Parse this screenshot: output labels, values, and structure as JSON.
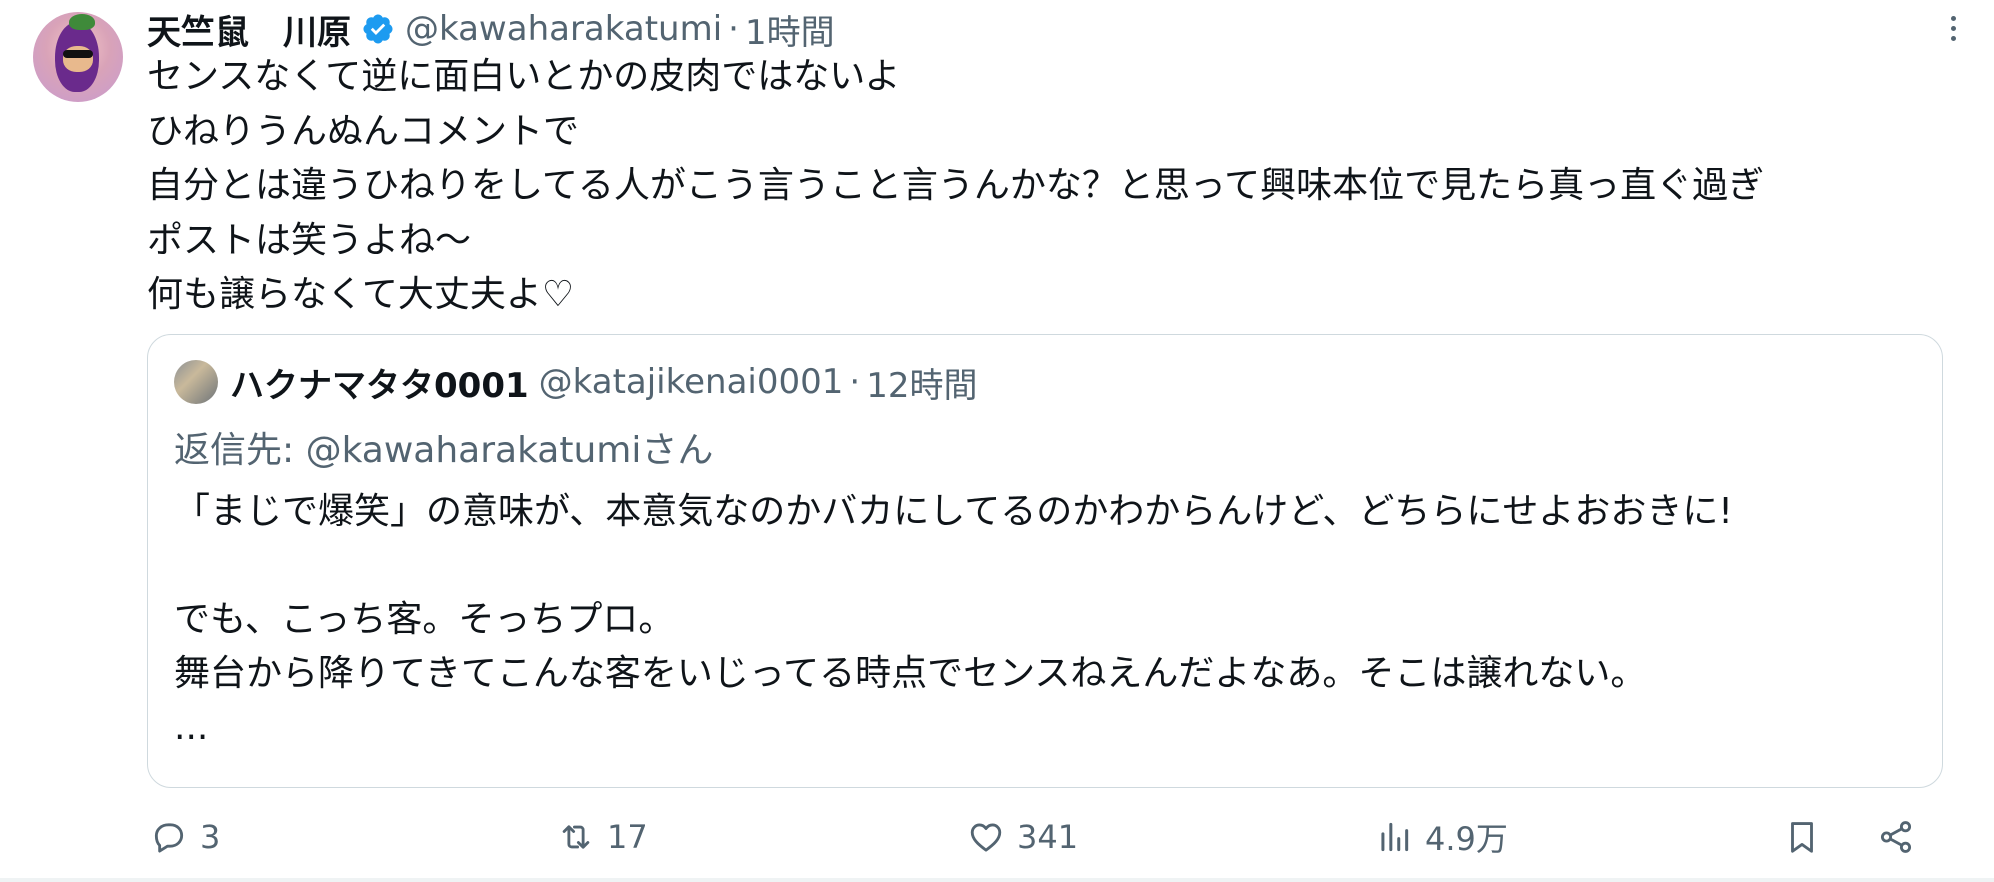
{
  "tweet": {
    "author": {
      "display_name": "天竺鼠　川原",
      "handle": "@kawaharakatumi",
      "separator": "·",
      "time": "1時間",
      "verified": true
    },
    "body_lines": [
      "センスなくて逆に面白いとかの皮肉ではないよ",
      "ひねりうんぬんコメントで",
      "自分とは違うひねりをしてる人がこう言うこと言うんかな？と思って興味本位で見たら真っ直ぐ過ぎ",
      "ポストは笑うよね〜",
      "何も譲らなくて大丈夫よ♡"
    ],
    "quote": {
      "display_name": "ハクナマタタ0001",
      "handle": "@katajikenai0001",
      "separator": "·",
      "time": "12時間",
      "reply_prefix": "返信先: ",
      "reply_to": "@kawaharakatumi",
      "reply_suffix": "さん",
      "body_lines": [
        "「まじで爆笑」の意味が、本意気なのかバカにしてるのかわからんけど、どちらにせよおおきに!",
        "",
        "でも、こっち客。そっちプロ。",
        "舞台から降りてきてこんな客をいじってる時点でセンスねえんだよなあ。そこは譲れない。",
        "..."
      ]
    },
    "actions": {
      "reply_count": "3",
      "retweet_count": "17",
      "like_count": "341",
      "view_count": "4.9万"
    }
  },
  "icons": {
    "verified": "verified-badge-icon",
    "more": "more-options-icon",
    "reply": "reply-icon",
    "retweet": "retweet-icon",
    "like": "heart-icon",
    "views": "views-icon",
    "bookmark": "bookmark-icon",
    "share": "share-icon"
  },
  "colors": {
    "verified": "#1d9bf0",
    "secondary_text": "#536471",
    "primary_text": "#0f1419",
    "border": "#cfd9de"
  }
}
